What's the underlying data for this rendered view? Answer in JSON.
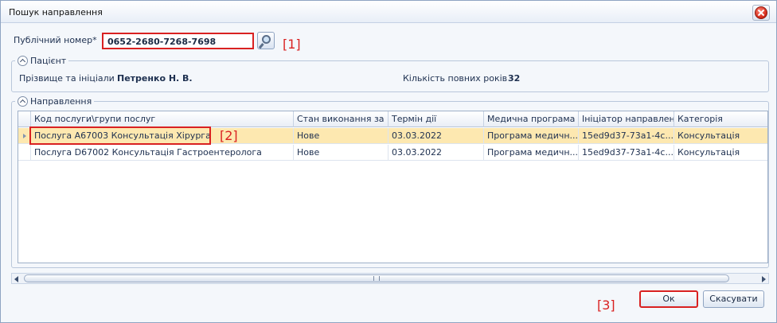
{
  "window": {
    "title": "Пошук направлення"
  },
  "search": {
    "label": "Публічний номер*",
    "value": "0652-2680-7268-7698",
    "marker": "[1]"
  },
  "patient": {
    "group_title": "Пацієнт",
    "name_label": "Прізвище та ініціали",
    "name_value": "Петренко Н. В.",
    "age_label": "Кількість повних років",
    "age_value": "32"
  },
  "referrals": {
    "group_title": "Направлення",
    "columns": [
      "Код послуги\\групи послуг",
      "Стан виконання за г",
      "Термін дії",
      "Медична програма",
      "Ініціатор направлен",
      "Категорія"
    ],
    "rows": [
      [
        "Послуга A67003 Консультація Хірурга",
        "Нове",
        "03.03.2022",
        "Програма медичн...",
        "15ed9d37-73a1-4c...",
        "Консультація"
      ],
      [
        "Послуга D67002 Консультація Гастроентеролога",
        "Нове",
        "03.03.2022",
        "Програма медичн...",
        "15ed9d37-73a1-4c...",
        "Консультація"
      ]
    ],
    "marker": "[2]"
  },
  "buttons": {
    "ok": "Ок",
    "cancel": "Скасувати",
    "marker": "[3]"
  },
  "colors": {
    "highlight": "#d92121",
    "selected_row": "#fde8b0"
  }
}
